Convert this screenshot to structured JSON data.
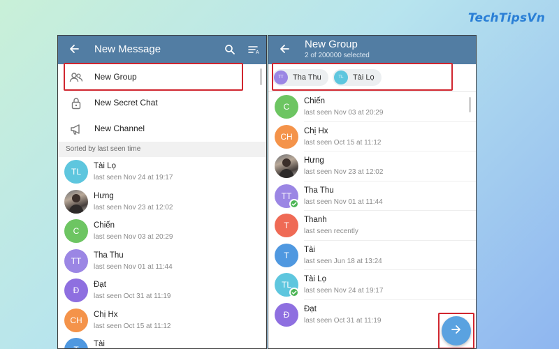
{
  "watermark": "TechTipsVn",
  "colors": {
    "header_bg": "#527da3",
    "highlight": "#d0262f",
    "fab": "#5aa2e0",
    "check": "#4cb555"
  },
  "left_panel": {
    "header": {
      "title": "New Message",
      "back_icon": "arrow-left-icon",
      "search_icon": "search-icon",
      "sort_icon": "sort-icon"
    },
    "menu": [
      {
        "label": "New Group",
        "icon": "group-icon"
      },
      {
        "label": "New Secret Chat",
        "icon": "lock-icon"
      },
      {
        "label": "New Channel",
        "icon": "megaphone-icon"
      }
    ],
    "section_title": "Sorted by last seen time",
    "contacts": [
      {
        "initials": "TL",
        "name": "Tài Lọ",
        "status": "last seen Nov 24 at 19:17",
        "color": "#5ec6de"
      },
      {
        "initials": "",
        "name": "Hưng",
        "status": "last seen Nov 23 at 12:02",
        "color": "#777777"
      },
      {
        "initials": "C",
        "name": "Chiến",
        "status": "last seen Nov 03 at 20:29",
        "color": "#6dc562"
      },
      {
        "initials": "TT",
        "name": "Tha Thu",
        "status": "last seen Nov 01 at 11:44",
        "color": "#9b86e4"
      },
      {
        "initials": "Đ",
        "name": "Đạt",
        "status": "last seen Oct 31 at 11:19",
        "color": "#8e6fe0"
      },
      {
        "initials": "CH",
        "name": "Chị Hx",
        "status": "last seen Oct 15 at 11:12",
        "color": "#f4934a"
      },
      {
        "initials": "T",
        "name": "Tài",
        "status": "",
        "color": "#4f98e0"
      }
    ]
  },
  "right_panel": {
    "header": {
      "title": "New Group",
      "subtitle": "2 of 200000 selected",
      "back_icon": "arrow-left-icon"
    },
    "chips": [
      {
        "initials": "TT",
        "label": "Tha Thu",
        "color": "#9b86e4"
      },
      {
        "initials": "TL",
        "label": "Tài Lọ",
        "color": "#5ec6de"
      }
    ],
    "contacts": [
      {
        "initials": "C",
        "name": "Chiến",
        "status": "last seen Nov 03 at 20:29",
        "color": "#6dc562",
        "selected": false
      },
      {
        "initials": "CH",
        "name": "Chị Hx",
        "status": "last seen Oct 15 at 11:12",
        "color": "#f4934a",
        "selected": false
      },
      {
        "initials": "",
        "name": "Hưng",
        "status": "last seen Nov 23 at 12:02",
        "color": "#777777",
        "selected": false
      },
      {
        "initials": "TT",
        "name": "Tha Thu",
        "status": "last seen Nov 01 at 11:44",
        "color": "#9b86e4",
        "selected": true
      },
      {
        "initials": "T",
        "name": "Thanh",
        "status": "last seen recently",
        "color": "#ef6a55",
        "selected": false
      },
      {
        "initials": "T",
        "name": "Tài",
        "status": "last seen Jun 18 at 13:24",
        "color": "#4f98e0",
        "selected": false
      },
      {
        "initials": "TL",
        "name": "Tài Lọ",
        "status": "last seen Nov 24 at 19:17",
        "color": "#5ec6de",
        "selected": true
      },
      {
        "initials": "Đ",
        "name": "Đạt",
        "status": "last seen Oct 31 at 11:19",
        "color": "#8e6fe0",
        "selected": false
      }
    ],
    "fab_icon": "arrow-right-icon"
  }
}
